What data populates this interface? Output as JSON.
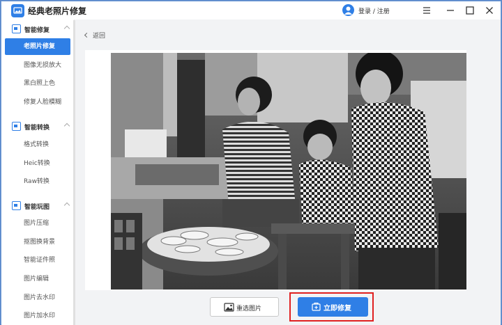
{
  "app": {
    "title": "经典老照片修复"
  },
  "header": {
    "login_label": "登录 / 注册"
  },
  "sidebar": {
    "groups": [
      {
        "label": "智能修复",
        "items": [
          "老照片修复",
          "图像无损放大",
          "黑白照上色",
          "修复人脸模糊"
        ]
      },
      {
        "label": "智能转换",
        "items": [
          "格式转换",
          "Heic转换",
          "Raw转换"
        ]
      },
      {
        "label": "智能玩图",
        "items": [
          "图片压缩",
          "抠图换背景",
          "智能证件照",
          "图片编辑",
          "图片去水印",
          "图片加水印"
        ]
      }
    ],
    "active_item": "老照片修复"
  },
  "main": {
    "back_label": "返回",
    "reselect_label": "重选图片",
    "repair_label": "立即修复"
  },
  "colors": {
    "accent": "#2f7fe6",
    "highlight": "#e02020",
    "frame": "#5a87c9"
  }
}
